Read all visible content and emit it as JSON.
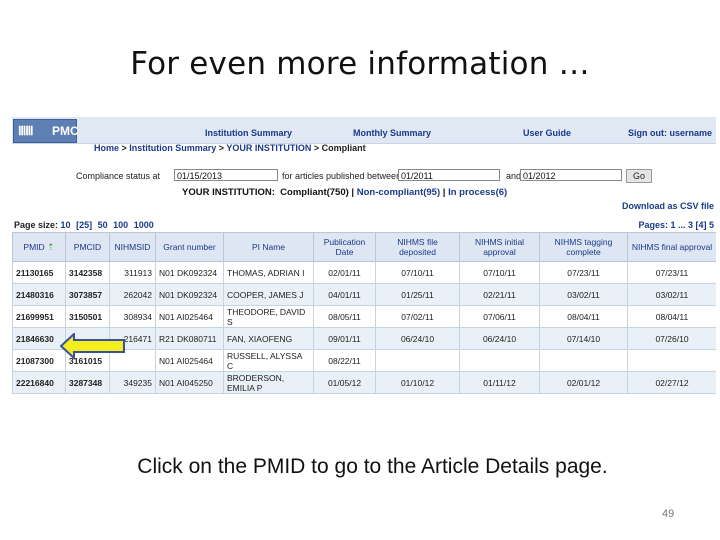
{
  "slide": {
    "title": "For even more information …",
    "caption": "Click on the PMID to go to the Article Details page.",
    "page_number": "49"
  },
  "app": {
    "logo_text": "PMC",
    "nav": [
      "Institution Summary",
      "Monthly Summary",
      "User Guide",
      "Sign out: username"
    ],
    "breadcrumb": {
      "home": "Home",
      "sep1": " > ",
      "summary": "Institution Summary",
      "sep2": " > ",
      "institution": "YOUR INSTITUTION",
      "sep3": " > ",
      "current": "Compliant"
    }
  },
  "filters": {
    "status_label": "Compliance status at",
    "status_date": "01/15/2013",
    "range_label": "for articles published between",
    "from_date": "01/2011",
    "and_label": "and",
    "to_date": "01/2012",
    "go_label": "Go"
  },
  "institution_line": {
    "label": "YOUR INSTITUTION:",
    "compliant": "Compliant(750)",
    "sep1": " | ",
    "noncompliant": "Non-compliant(95)",
    "sep2": " | ",
    "inprocess": "In process(6)"
  },
  "download_label": "Download as CSV file",
  "page_size": {
    "label": "Page size:",
    "options": [
      "10",
      "[25]",
      "50",
      "100",
      "1000"
    ]
  },
  "pagination": "Pages: 1 ... 3 [4] 5",
  "table": {
    "headers": [
      "PMID",
      "PMCID",
      "NIHMSID",
      "Grant number",
      "PI Name",
      "Publication Date",
      "NIHMS file deposited",
      "NIHMS initial approval",
      "NIHMS tagging complete",
      "NIHMS final approval"
    ],
    "rows": [
      [
        "21130165",
        "3142358",
        "311913",
        "N01 DK092324",
        "THOMAS, ADRIAN I",
        "02/01/11",
        "07/10/11",
        "07/10/11",
        "07/23/11",
        "07/23/11"
      ],
      [
        "21480316",
        "3073857",
        "262042",
        "N01 DK092324",
        "COOPER, JAMES J",
        "04/01/11",
        "01/25/11",
        "02/21/11",
        "03/02/11",
        "03/02/11"
      ],
      [
        "21699951",
        "3150501",
        "308934",
        "N01 AI025464",
        "THEODORE, DAVID S",
        "08/05/11",
        "07/02/11",
        "07/06/11",
        "08/04/11",
        "08/04/11"
      ],
      [
        "21846630",
        "",
        "216471",
        "R21 DK080711",
        "FAN, XIAOFENG",
        "09/01/11",
        "06/24/10",
        "06/24/10",
        "07/14/10",
        "07/26/10"
      ],
      [
        "21087300",
        "3161015",
        "",
        "N01 AI025464",
        "RUSSELL, ALYSSA C",
        "08/22/11",
        "",
        "",
        "",
        ""
      ],
      [
        "22216840",
        "3287348",
        "349235",
        "N01 AI045250",
        "BRODERSON, EMILIA P",
        "01/05/12",
        "01/10/12",
        "01/11/12",
        "02/01/12",
        "02/27/12"
      ]
    ]
  },
  "colors": {
    "link": "#1a3a8a",
    "header_bg": "#dde6f2",
    "arrow_fill": "#f4ee1c",
    "arrow_stroke": "#3a4fa6"
  }
}
